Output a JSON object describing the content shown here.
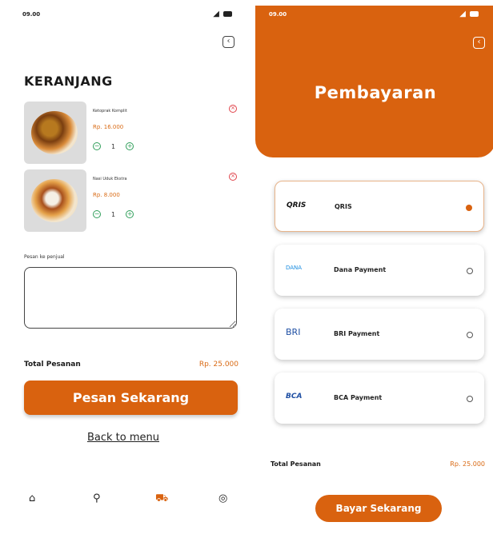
{
  "left": {
    "status": {
      "time": "09.00",
      "signal": "◢"
    },
    "back_icon": "‹",
    "title": "KERANJANG",
    "items": [
      {
        "name": "Ketoprak Komplit",
        "price": "Rp. 16.000",
        "qty": "1"
      },
      {
        "name": "Nasi Uduk Ekstra",
        "price": "Rp. 8.000",
        "qty": "1"
      }
    ],
    "note_label": "Pesan ke penjual",
    "total_label": "Total Pesanan",
    "total_value": "Rp. 25.000",
    "order_button": "Pesan Sekarang",
    "back_to_menu": "Back to menu",
    "nav": [
      {
        "icon": "home-icon",
        "glyph": "⌂"
      },
      {
        "icon": "search-icon",
        "glyph": "⚲"
      },
      {
        "icon": "cart-icon",
        "glyph": "🛒"
      },
      {
        "icon": "profile-icon",
        "glyph": "◎"
      }
    ]
  },
  "right": {
    "status": {
      "time": "09.00",
      "signal": "◢"
    },
    "back_icon": "‹",
    "title": "Pembayaran",
    "methods": [
      {
        "logo": "QRIS",
        "label": "QRIS",
        "selected": true
      },
      {
        "logo": "DANA",
        "label": "Dana Payment",
        "selected": false
      },
      {
        "logo": "BRI",
        "label": "BRI Payment",
        "selected": false
      },
      {
        "logo": "BCA",
        "label": "BCA Payment",
        "selected": false
      }
    ],
    "total_label": "Total Pesanan",
    "total_value": "Rp. 25.000",
    "pay_button": "Bayar Sekarang"
  },
  "colors": {
    "accent": "#d9620f",
    "price": "#d96a14",
    "qty_green": "#2f9e5a",
    "remove_red": "#e0424a"
  }
}
